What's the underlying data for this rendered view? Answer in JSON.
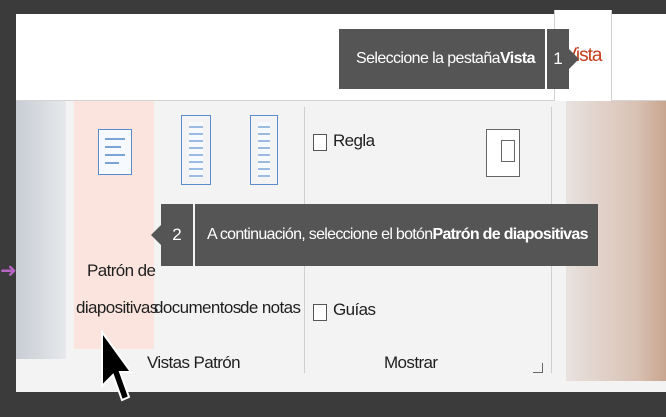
{
  "tabs": {
    "active_label": "Vista"
  },
  "callouts": {
    "step1": {
      "number": "1",
      "text_prefix": "Seleccione la pestaña ",
      "text_bold": "Vista"
    },
    "step2": {
      "number": "2",
      "text_prefix": "A continuación, seleccione el botón ",
      "text_bold": "Patrón de diapositivas"
    }
  },
  "ribbon": {
    "vistas_patron": {
      "group_label": "Vistas Patrón",
      "patron_diapositivas": {
        "line1": "Patrón de",
        "line2": "diapositivas"
      },
      "patron_documentos": {
        "line2": "documentos"
      },
      "patron_notas": {
        "line2": "de notas"
      }
    },
    "mostrar": {
      "group_label": "Mostrar",
      "regla": "Regla",
      "guias": "Guías"
    }
  },
  "colors": {
    "accent": "#c43e1c",
    "callout_bg": "#555555",
    "highlight": "#fbe4de"
  }
}
